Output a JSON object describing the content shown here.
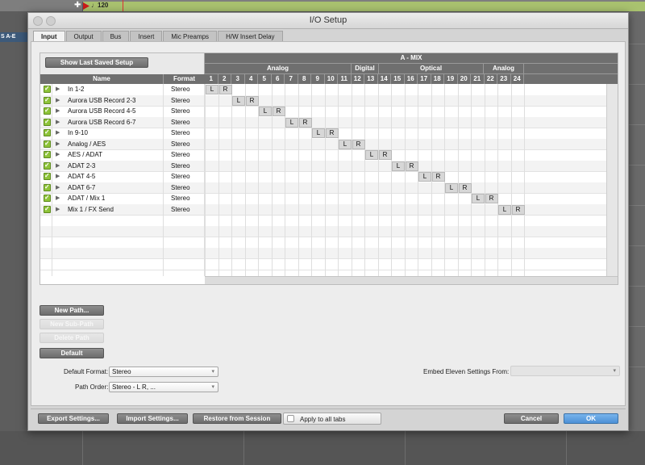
{
  "daw": {
    "tempo_label": "♩120",
    "track_label": "S A-E"
  },
  "window": {
    "title": "I/O Setup"
  },
  "tabs": [
    "Input",
    "Output",
    "Bus",
    "Insert",
    "Mic Preamps",
    "H/W Insert Delay"
  ],
  "active_tab": "Input",
  "io": {
    "show_last_saved_label": "Show Last Saved Setup",
    "name_header": "Name",
    "format_header": "Format",
    "device_header": "A - MIX",
    "groups": [
      "Analog",
      "Digital",
      "Optical",
      "Analog"
    ],
    "channels": [
      "1",
      "2",
      "3",
      "4",
      "5",
      "6",
      "7",
      "8",
      "9",
      "10",
      "11",
      "12",
      "13",
      "14",
      "15",
      "16",
      "17",
      "18",
      "19",
      "20",
      "21",
      "22",
      "23",
      "24"
    ],
    "rows": [
      {
        "name": "In 1-2",
        "format": "Stereo",
        "checked": true
      },
      {
        "name": "Aurora USB Record 2-3",
        "format": "Stereo",
        "checked": true
      },
      {
        "name": "Aurora USB Record 4-5",
        "format": "Stereo",
        "checked": true
      },
      {
        "name": "Aurora USB Record 6-7",
        "format": "Stereo",
        "checked": true
      },
      {
        "name": "In 9-10",
        "format": "Stereo",
        "checked": true
      },
      {
        "name": "Analog / AES",
        "format": "Stereo",
        "checked": true
      },
      {
        "name": "AES / ADAT",
        "format": "Stereo",
        "checked": true
      },
      {
        "name": "ADAT 2-3",
        "format": "Stereo",
        "checked": true
      },
      {
        "name": "ADAT 4-5",
        "format": "Stereo",
        "checked": true
      },
      {
        "name": "ADAT 6-7",
        "format": "Stereo",
        "checked": true
      },
      {
        "name": "ADAT / Mix 1",
        "format": "Stereo",
        "checked": true
      },
      {
        "name": "Mix 1 / FX Send",
        "format": "Stereo",
        "checked": true
      }
    ],
    "left_label": "L",
    "right_label": "R"
  },
  "buttons": {
    "new_path": "New Path...",
    "new_sub_path": "New Sub-Path",
    "delete_path": "Delete Path",
    "default": "Default",
    "export": "Export Settings...",
    "import": "Import Settings...",
    "restore": "Restore from Session",
    "cancel": "Cancel",
    "ok": "OK"
  },
  "form": {
    "default_format_label": "Default Format:",
    "default_format_value": "Stereo",
    "path_order_label": "Path Order:",
    "path_order_value": "Stereo - L R, ...",
    "embed_label": "Embed Eleven Settings From:",
    "embed_value": "",
    "apply_all_label": "Apply to all tabs"
  },
  "colors": {
    "check": "#8fc43a",
    "ok_button": "#4c90d6",
    "header": "#6f6f6f"
  }
}
